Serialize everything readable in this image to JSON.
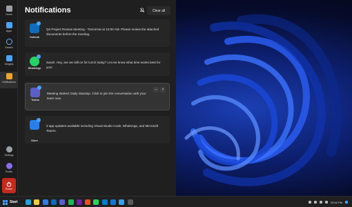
{
  "panel": {
    "title": "Notifications",
    "clear_all_label": "Clear all"
  },
  "sidebar": {
    "items": [
      {
        "label": "Home",
        "icon": "home-icon",
        "color": "#9aa0a6"
      },
      {
        "label": "Apps",
        "icon": "apps-icon",
        "color": "#4aa3ff"
      },
      {
        "label": "Search",
        "icon": "search-icon",
        "color": "#6ab0ff"
      },
      {
        "label": "Widgets",
        "icon": "widgets-icon",
        "color": "#4aa3ff"
      },
      {
        "label": "Notifications",
        "icon": "bell-icon",
        "color": "#f3a32b"
      },
      {
        "label": "Settings",
        "icon": "gear-icon",
        "color": "#9aa0a6"
      },
      {
        "label": "Profile",
        "icon": "profile-icon",
        "color": "#8a6cf0"
      }
    ],
    "power_label": "Power"
  },
  "notifications": [
    {
      "app": "Outlook",
      "icon_color": "#0f6cbd",
      "message": "Q4 Project Review Meeting - Tomorrow at 10:00 AM. Please review the attached documents before the meeting."
    },
    {
      "app": "WhatsApp",
      "icon_color": "#25d366",
      "message": "Sarah: Hey, are we still on for lunch today? Let me know what time works best for you!"
    },
    {
      "app": "Teams",
      "icon_color": "#5b5fc7",
      "message": "Meeting started: Daily Standup. Click to join the conversation with your team now."
    },
    {
      "app": "Store",
      "icon_color": "#2b7de9",
      "message": "3 app updates available including Visual Studio Code, WhatsApp, and Microsoft Teams."
    }
  ],
  "taskbar": {
    "start_label": "Start",
    "apps": [
      {
        "name": "edge-icon",
        "color": "#1fa3e0"
      },
      {
        "name": "file-explorer-icon",
        "color": "#f2c94c"
      },
      {
        "name": "store-icon",
        "color": "#2b7de9"
      },
      {
        "name": "outlook-icon",
        "color": "#0f6cbd"
      },
      {
        "name": "teams-icon",
        "color": "#5b5fc7"
      },
      {
        "name": "spotify-icon",
        "color": "#1db954"
      },
      {
        "name": "onenote-icon",
        "color": "#7719aa"
      },
      {
        "name": "figma-icon",
        "color": "#f24e1e"
      },
      {
        "name": "whatsapp-icon",
        "color": "#25d366"
      },
      {
        "name": "vscode-icon",
        "color": "#007acc"
      },
      {
        "name": "onedrive-icon",
        "color": "#0f78d4"
      },
      {
        "name": "photos-icon",
        "color": "#3aa0e8"
      },
      {
        "name": "calculator-icon",
        "color": "#5a5a5a"
      }
    ],
    "clock": "00:00 PM"
  }
}
